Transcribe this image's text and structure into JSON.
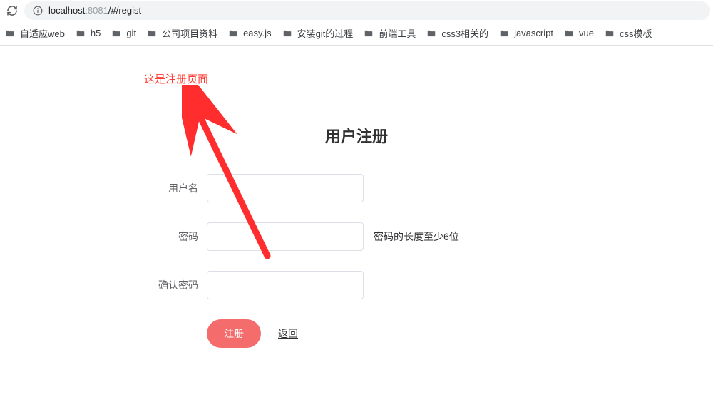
{
  "browser": {
    "url_host": "localhost",
    "url_port": ":8081",
    "url_path": "/#/regist"
  },
  "bookmarks": [
    {
      "label": "自适应web"
    },
    {
      "label": "h5"
    },
    {
      "label": "git"
    },
    {
      "label": "公司项目资料"
    },
    {
      "label": "easy.js"
    },
    {
      "label": "安装git的过程"
    },
    {
      "label": "前端工具"
    },
    {
      "label": "css3相关的"
    },
    {
      "label": "javascript"
    },
    {
      "label": "vue"
    },
    {
      "label": "css模板"
    }
  ],
  "annotation": {
    "text": "这是注册页面"
  },
  "form": {
    "title": "用户注册",
    "username_label": "用户名",
    "username_value": "",
    "password_label": "密码",
    "password_value": "",
    "password_hint": "密码的长度至少6位",
    "confirm_label": "确认密码",
    "confirm_value": "",
    "submit_label": "注册",
    "back_label": "返回"
  }
}
